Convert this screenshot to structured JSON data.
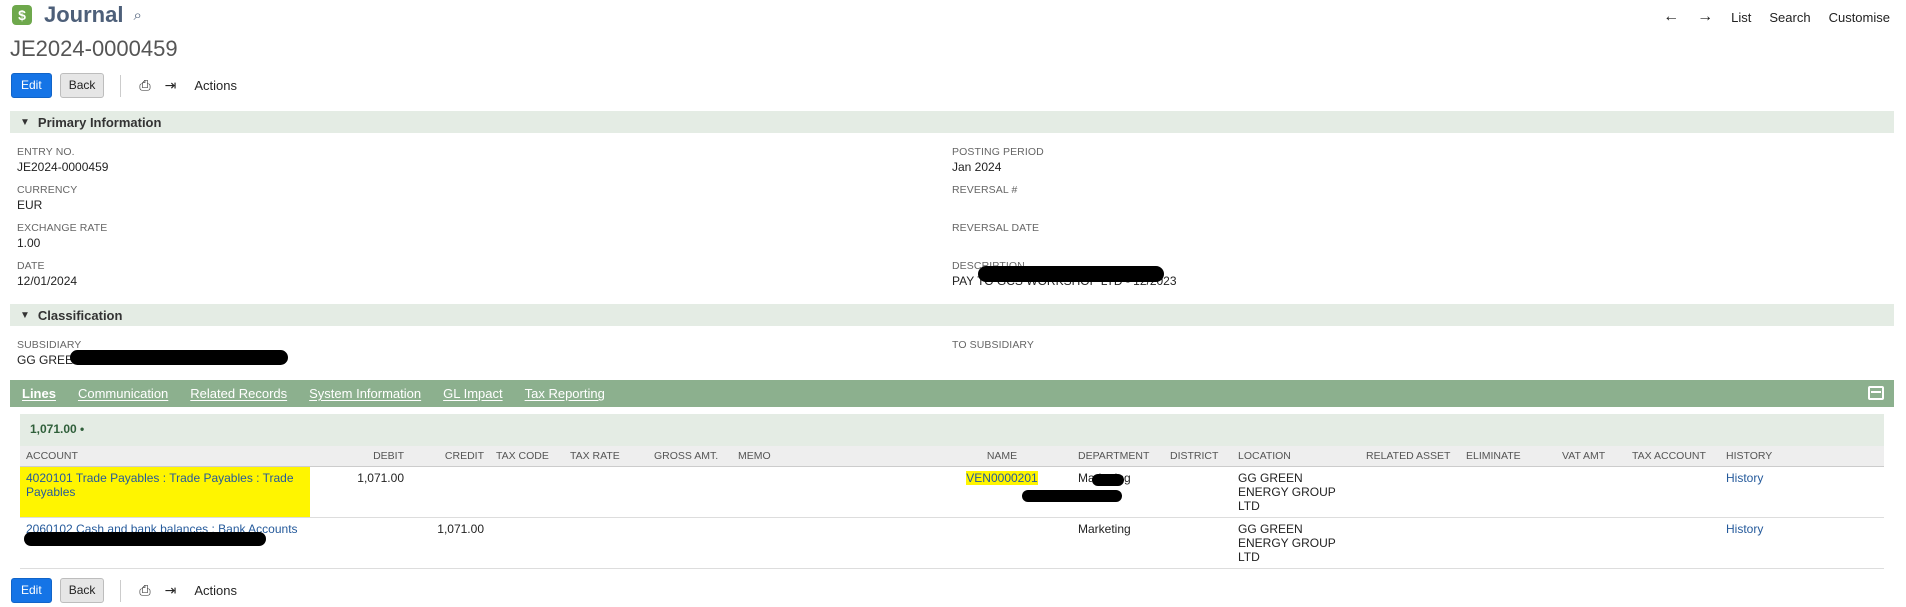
{
  "header": {
    "app_icon_glyph": "$",
    "app_title": "Journal",
    "record_id": "JE2024-0000459",
    "nav": {
      "back_icon": "left-arrow-icon",
      "forward_icon": "right-arrow-icon",
      "list": "List",
      "search": "Search",
      "customise": "Customise"
    }
  },
  "toolbar": {
    "edit": "Edit",
    "back": "Back",
    "actions": "Actions"
  },
  "primary": {
    "title": "Primary Information",
    "entry_no_label": "ENTRY NO.",
    "entry_no": "JE2024-0000459",
    "currency_label": "CURRENCY",
    "currency": "EUR",
    "exchange_rate_label": "EXCHANGE RATE",
    "exchange_rate": "1.00",
    "date_label": "DATE",
    "date": "12/01/2024",
    "posting_period_label": "POSTING PERIOD",
    "posting_period": "Jan 2024",
    "reversal_no_label": "REVERSAL #",
    "reversal_date_label": "REVERSAL DATE",
    "description_label": "DESCRIPTION",
    "description": "PAY TO GCS WORKSHOP LTD - 12/2023"
  },
  "classification": {
    "title": "Classification",
    "subsidiary_label": "SUBSIDIARY",
    "subsidiary": "GG GREEN",
    "to_subsidiary_label": "TO SUBSIDIARY"
  },
  "tabs": [
    "Lines",
    "Communication",
    "Related Records",
    "System Information",
    "GL Impact",
    "Tax Reporting"
  ],
  "lines": {
    "total": "1,071.00 •",
    "columns": [
      "ACCOUNT",
      "DEBIT",
      "CREDIT",
      "TAX CODE",
      "TAX RATE",
      "GROSS AMT.",
      "MEMO",
      "NAME",
      "DEPARTMENT",
      "DISTRICT",
      "LOCATION",
      "RELATED ASSET",
      "ELIMINATE",
      "VAT AMT",
      "TAX ACCOUNT",
      "HISTORY"
    ],
    "rows": [
      {
        "account": "4020101 Trade Payables : Trade Payables : Trade Payables",
        "debit": "1,071.00",
        "credit": "",
        "name": "VEN0000201",
        "department": "Marketing",
        "location": "GG GREEN ENERGY GROUP LTD",
        "history": "History"
      },
      {
        "account": "2060102 Cash and bank balances : Bank Accounts",
        "debit": "",
        "credit": "1,071.00",
        "name": "",
        "department": "Marketing",
        "location": "GG GREEN ENERGY GROUP LTD",
        "history": "History"
      }
    ]
  },
  "colors": {
    "edit_button": "#1574e6",
    "tab_bar": "#8cb08e",
    "section_bar": "#e4ece4",
    "highlight": "#fff500",
    "link": "#255a9b"
  }
}
